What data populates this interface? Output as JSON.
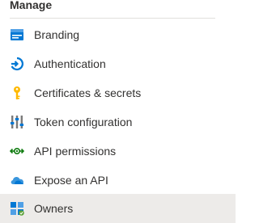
{
  "nav": {
    "section_title": "Manage",
    "items": [
      {
        "label": "Branding",
        "icon": "branding-icon",
        "selected": false
      },
      {
        "label": "Authentication",
        "icon": "authentication-icon",
        "selected": false
      },
      {
        "label": "Certificates & secrets",
        "icon": "key-icon",
        "selected": false
      },
      {
        "label": "Token configuration",
        "icon": "token-configuration-icon",
        "selected": false
      },
      {
        "label": "API permissions",
        "icon": "api-permissions-icon",
        "selected": false
      },
      {
        "label": "Expose an API",
        "icon": "cloud-icon",
        "selected": false
      },
      {
        "label": "Owners",
        "icon": "owners-icon",
        "selected": true
      }
    ]
  },
  "colors": {
    "text": "#323130",
    "selected_bg": "#edebe9",
    "divider": "#e1dfdd",
    "accent_blue": "#0078d4",
    "key_gold": "#ffb900",
    "owners_green": "#5ea33a"
  }
}
